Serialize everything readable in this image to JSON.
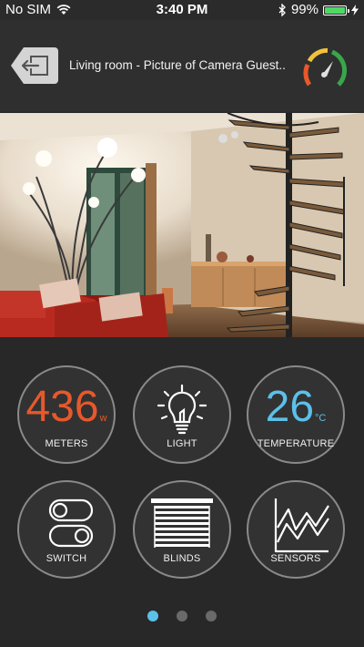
{
  "status_bar": {
    "carrier": "No SIM",
    "time": "3:40 PM",
    "battery_percent": "99%",
    "battery_level": 0.99,
    "icons": [
      "wifi-icon",
      "bluetooth-icon",
      "battery-icon",
      "charging-icon"
    ]
  },
  "header": {
    "title": "Living room - Picture of Camera Guest..",
    "back_icon": "exit-icon",
    "gauge_icon": "gauge-icon"
  },
  "camera": {
    "image": "living-room-camera-picture"
  },
  "tiles": [
    {
      "id": "meters",
      "value": "436",
      "unit": "w",
      "label": "METERS",
      "color": "#e8582a"
    },
    {
      "id": "light",
      "label": "LIGHT",
      "icon": "lightbulb-icon"
    },
    {
      "id": "temperature",
      "value": "26",
      "unit": "°C",
      "label": "TEMPERATURE",
      "color": "#5bc0ea"
    },
    {
      "id": "switch",
      "label": "SWITCH",
      "icon": "toggle-switch-icon"
    },
    {
      "id": "blinds",
      "label": "BLINDS",
      "icon": "blinds-icon"
    },
    {
      "id": "sensors",
      "label": "SENSORS",
      "icon": "chart-icon"
    }
  ],
  "pagination": {
    "total": 3,
    "current": 1
  },
  "colors": {
    "accent_blue": "#5bc0ea",
    "accent_orange": "#e8582a",
    "gauge_green": "#3aa54a",
    "gauge_red": "#e8452a"
  }
}
